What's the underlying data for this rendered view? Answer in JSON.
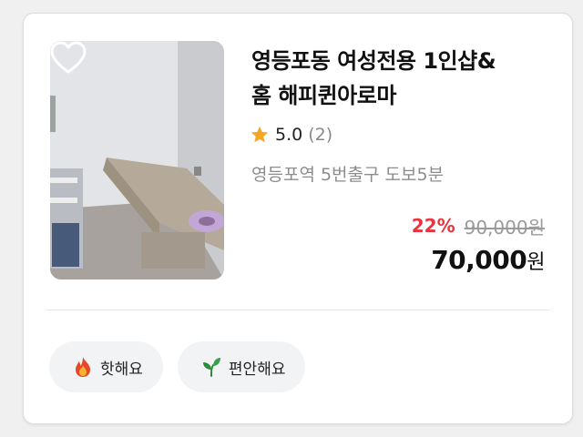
{
  "product": {
    "title_line1": "영등포동 여성전용 1인샵&",
    "title_line2": "홈 해피퀸아로마",
    "rating_score": "5.0",
    "rating_count": "(2)",
    "location": "영등포역 5번출구 도보5분",
    "discount": "22%",
    "original_price": "90,000원",
    "final_price_number": "70,000",
    "final_price_unit": "원",
    "favorite_icon": "heart-outline-icon",
    "star_icon": "star-icon",
    "star_color": "#f5a623"
  },
  "tags": [
    {
      "label": "핫해요",
      "icon": "fire-icon"
    },
    {
      "label": "편안해요",
      "icon": "leaf-icon"
    }
  ],
  "colors": {
    "discount": "#e8343f",
    "chip_background": "#f2f3f5"
  }
}
